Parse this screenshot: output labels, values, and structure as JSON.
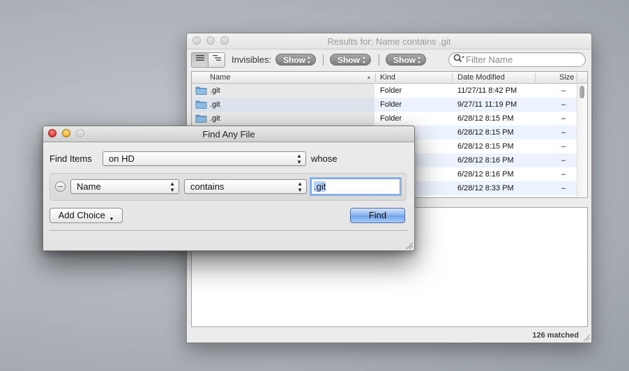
{
  "results_window": {
    "title": "Results for: Name contains .git",
    "toolbar": {
      "view_list_icon": "list-view-icon",
      "view_tree_icon": "outline-view-icon",
      "invisibles_label": "Invisibles:",
      "show_buttons": [
        "Show",
        "Show",
        "Show"
      ],
      "filter_placeholder": "Filter Name"
    },
    "columns": [
      "Name",
      "Kind",
      "Date Modified",
      "Size"
    ],
    "rows": [
      {
        "name": ".git",
        "kind": "Folder",
        "date": "11/27/11 8:42 PM",
        "size": "–"
      },
      {
        "name": ".git",
        "kind": "Folder",
        "date": "9/27/11 11:19 PM",
        "size": "–"
      },
      {
        "name": ".git",
        "kind": "Folder",
        "date": "6/28/12 8:15 PM",
        "size": "–"
      },
      {
        "name": "",
        "kind": "",
        "date": "6/28/12 8:15 PM",
        "size": "–"
      },
      {
        "name": "",
        "kind": "",
        "date": "6/28/12 8:15 PM",
        "size": "–"
      },
      {
        "name": "",
        "kind": "",
        "date": "6/28/12 8:16 PM",
        "size": "–"
      },
      {
        "name": "",
        "kind": "",
        "date": "6/28/12 8:16 PM",
        "size": "–"
      },
      {
        "name": "",
        "kind": "",
        "date": "6/28/12 8:33 PM",
        "size": "–"
      }
    ],
    "status": "126 matched"
  },
  "find_window": {
    "title": "Find Any File",
    "find_items_label": "Find Items",
    "location_value": "on HD",
    "whose_label": "whose",
    "criterion": {
      "attribute": "Name",
      "operator": "contains",
      "value": ".git"
    },
    "add_choice_label": "Add Choice",
    "find_label": "Find"
  }
}
